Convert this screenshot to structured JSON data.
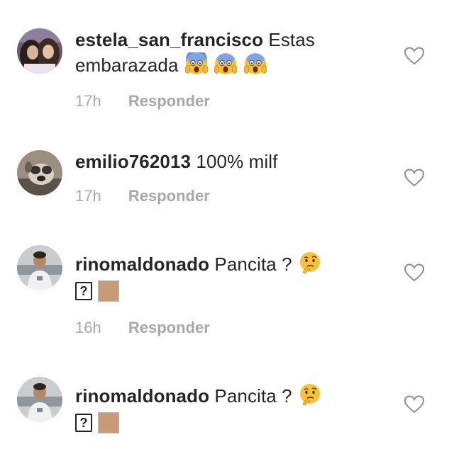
{
  "colors": {
    "text": "#262626",
    "meta": "#a8a8a8",
    "heart_outline": "#8e8e8e",
    "skin_swatch": "#c89a78"
  },
  "reply_label": "Responder",
  "comments": [
    {
      "username": "estela_san_francisco",
      "text": "Estas embarazada",
      "emojis": [
        "face-screaming-in-fear-icon",
        "face-screaming-in-fear-icon",
        "face-screaming-in-fear-icon"
      ],
      "time": "17h"
    },
    {
      "username": "emilio762013",
      "text": "100% milf",
      "emojis": [],
      "time": "17h"
    },
    {
      "username": "rinomaldonado",
      "text": "Pancita ?",
      "emojis": [
        "thinking-face-icon"
      ],
      "extra_glyphs": [
        "?"
      ],
      "time": "16h"
    },
    {
      "username": "rinomaldonado",
      "text": "Pancita ?",
      "emojis": [
        "thinking-face-icon"
      ],
      "extra_glyphs": [
        "?"
      ]
    }
  ]
}
